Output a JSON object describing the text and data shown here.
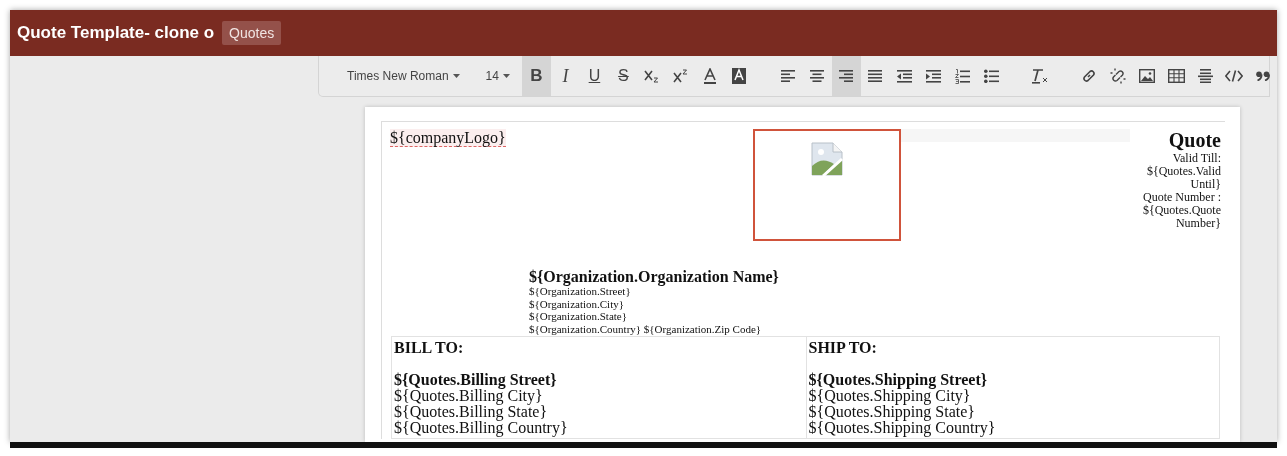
{
  "header": {
    "title": "Quote Template- clone o",
    "module_badge": "Quotes"
  },
  "toolbar": {
    "font_family": "Times New Roman",
    "font_size": "14",
    "tool_groups": [
      {
        "tools": [
          {
            "kind": "bold",
            "label": "B",
            "selected": true
          },
          {
            "kind": "italic",
            "label": "I",
            "selected": false
          },
          {
            "kind": "underline",
            "label": "U",
            "selected": false
          },
          {
            "kind": "strike",
            "label": "S",
            "selected": false
          },
          {
            "kind": "subscript",
            "selected": false
          },
          {
            "kind": "superscript",
            "selected": false
          },
          {
            "kind": "font-color",
            "selected": false
          },
          {
            "kind": "background-color",
            "selected": false
          }
        ]
      },
      {
        "tools": [
          {
            "kind": "align-left",
            "selected": false
          },
          {
            "kind": "align-center",
            "selected": false
          },
          {
            "kind": "align-right",
            "selected": true
          },
          {
            "kind": "justify",
            "selected": false
          },
          {
            "kind": "outdent",
            "selected": false
          },
          {
            "kind": "indent",
            "selected": false
          },
          {
            "kind": "ordered-list",
            "selected": false
          },
          {
            "kind": "bullet-list",
            "selected": false
          }
        ]
      },
      {
        "tools": [
          {
            "kind": "clear-format",
            "selected": false
          }
        ]
      },
      {
        "tools": [
          {
            "kind": "link",
            "selected": false
          },
          {
            "kind": "unlink",
            "selected": false
          },
          {
            "kind": "image",
            "selected": false
          },
          {
            "kind": "table",
            "selected": false
          },
          {
            "kind": "rule",
            "selected": false
          },
          {
            "kind": "code",
            "selected": false
          },
          {
            "kind": "quote",
            "selected": false
          }
        ]
      }
    ]
  },
  "document": {
    "company_logo": "${companyLogo}",
    "quote_title": "Quote",
    "quote_details": [
      "Valid Till:",
      "${Quotes.Valid Until}",
      "Quote Number :",
      "${Quotes.Quote Number}"
    ],
    "organization": {
      "name": "${Organization.Organization Name}",
      "lines": [
        "${Organization.Street}",
        "${Organization.City}",
        "${Organization.State}",
        "${Organization.Country} ${Organization.Zip Code}"
      ]
    },
    "address_columns": [
      {
        "heading": "BILL TO:",
        "lines": [
          "${Quotes.Billing Street}",
          "${Quotes.Billing City}",
          "${Quotes.Billing State}",
          "${Quotes.Billing Country}"
        ]
      },
      {
        "heading": "SHIP TO:",
        "lines": [
          "${Quotes.Shipping Street}",
          "${Quotes.Shipping City}",
          "${Quotes.Shipping State}",
          "${Quotes.Shipping Country}"
        ]
      }
    ]
  }
}
